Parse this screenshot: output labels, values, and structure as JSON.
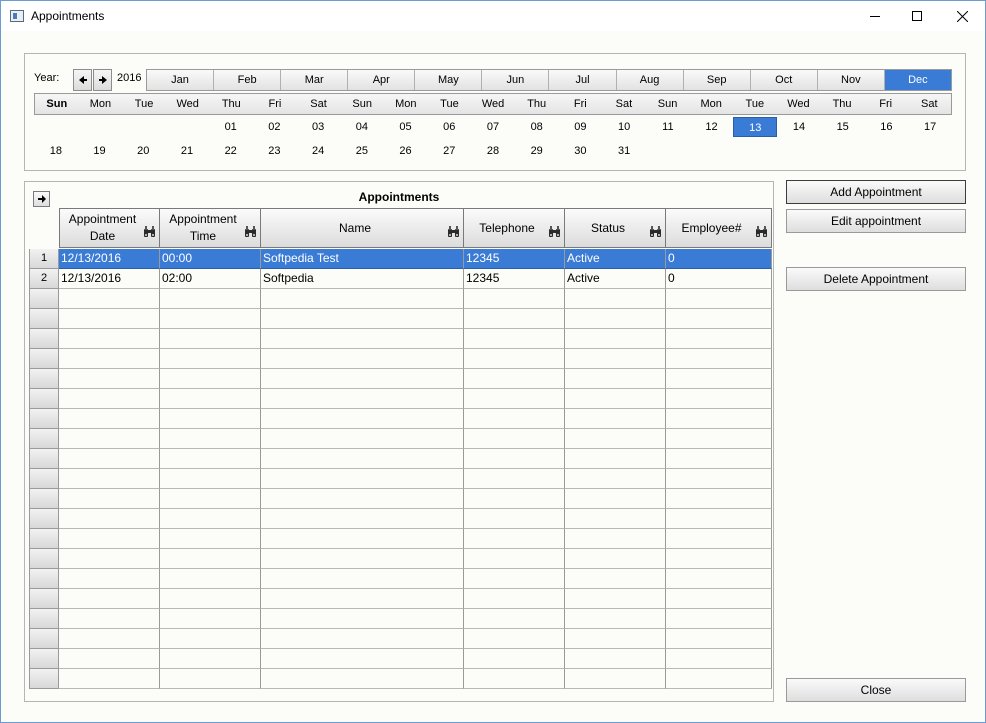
{
  "window": {
    "title": "Appointments"
  },
  "calendar": {
    "year_label": "Year:",
    "year": "2016",
    "months": [
      "Jan",
      "Feb",
      "Mar",
      "Apr",
      "May",
      "Jun",
      "Jul",
      "Aug",
      "Sep",
      "Oct",
      "Nov",
      "Dec"
    ],
    "selected_month": "Dec",
    "day_names": [
      "Sun",
      "Mon",
      "Tue",
      "Wed",
      "Thu",
      "Fri",
      "Sat",
      "Sun",
      "Mon",
      "Tue",
      "Wed",
      "Thu",
      "Fri",
      "Sat",
      "Sun",
      "Mon",
      "Tue",
      "Wed",
      "Thu",
      "Fri",
      "Sat"
    ],
    "week1": [
      "",
      "",
      "",
      "",
      "01",
      "02",
      "03",
      "04",
      "05",
      "06",
      "07",
      "08",
      "09",
      "10",
      "11",
      "12",
      "13",
      "14",
      "15",
      "16",
      "17"
    ],
    "week2": [
      "18",
      "19",
      "20",
      "21",
      "22",
      "23",
      "24",
      "25",
      "26",
      "27",
      "28",
      "29",
      "30",
      "31",
      "",
      "",
      "",
      "",
      "",
      "",
      ""
    ],
    "selected_date": "13"
  },
  "grid": {
    "title": "Appointments",
    "columns": [
      [
        "Appointment",
        "Date"
      ],
      [
        "Appointment",
        "Time"
      ],
      [
        "Name"
      ],
      [
        "Telephone"
      ],
      [
        "Status"
      ],
      [
        "Employee#"
      ]
    ],
    "rows": [
      {
        "num": "1",
        "cells": [
          "12/13/2016",
          "00:00",
          "Softpedia Test",
          "12345",
          "Active",
          "0"
        ]
      },
      {
        "num": "2",
        "cells": [
          "12/13/2016",
          "02:00",
          "Softpedia",
          "12345",
          "Active",
          "0"
        ]
      }
    ],
    "selected_row": 0
  },
  "buttons": {
    "add": "Add Appointment",
    "edit": "Edit appointment",
    "delete": "Delete Appointment",
    "close": "Close"
  }
}
